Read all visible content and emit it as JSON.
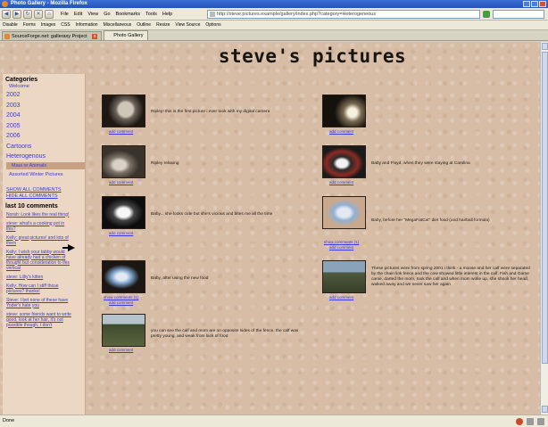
{
  "browser": {
    "title": "Photo Gallery - Mozilla Firefox",
    "menu": [
      "File",
      "Edit",
      "View",
      "Go",
      "Bookmarks",
      "Tools",
      "Help"
    ],
    "address": "http://steve.pictures.example/gallery/index.php?category=Heterogeneous",
    "bookmarks": [
      "Disable",
      "Forms",
      "Images",
      "CSS",
      "Information",
      "Miscellaneous",
      "Outline",
      "Resize",
      "View Source",
      "Options"
    ],
    "tabs": [
      {
        "label": "SourceForge.net: galleraxy Project"
      },
      {
        "label": "Photo Gallery"
      }
    ],
    "status": "Done"
  },
  "site": {
    "title": "steve's pictures"
  },
  "sidebar": {
    "categories_heading": "Categories",
    "welcome": "Welcome",
    "years": [
      "2002",
      "2003",
      "2004",
      "2005",
      "2006"
    ],
    "cartoons": "Cartoons",
    "heterogenous": "Heterogenous",
    "sub_active": "Maui or Animals",
    "sub_other": "Assorted Winter Pictures",
    "show_all": "SHOW ALL COMMENTS",
    "hide_all": "HIDE ALL COMMENTS",
    "comments_heading": "last 10 comments",
    "comments": [
      "Norah: Look likes the real thing!",
      "steve: what's a cooking pot in this?",
      "Kelly: great pictures! and lots of them",
      "Kelly: I wish your tabby would have already had a chicken of thought but consideration to this vertical",
      "steve: Lilliy's kitten",
      "Kelly: How can I stiff those pictures? thanks!",
      "Steve: I bet none of these have Yoder's hate you",
      "steve: some friends want to write good, look at her hair, it's not possible though, I don't"
    ]
  },
  "gallery": [
    {
      "caption": "Ripley! this is the first picture i ever took with my digital camera",
      "link": "add comment"
    },
    {
      "caption": "",
      "link": "add comment"
    },
    {
      "caption": "Ripley relaxing",
      "link": "add comment"
    },
    {
      "caption": "Baby and Floyd, when they were staying at Carolina",
      "link": "add comment"
    },
    {
      "caption": "Baby... she looks cute but she's vicious and bites me all the time",
      "link": "add comment"
    },
    {
      "caption": "Baby, before her \"MegaFatCat\" diet food (and hairball formula)",
      "link": "show comments (1)",
      "link2": "add comment"
    },
    {
      "caption": "Baby, after using the new food",
      "link": "show comments (1)",
      "link2": "add comment"
    },
    {
      "caption": "These pictures were from spring 2001 i think - a moose and her calf were separated by the chain link fence and the cow showed little interest in the calf. Fish and Game came, darted the mom, took the calf and when mom woke up, she shook her head, walked away and we never saw her again",
      "link": "add comment"
    },
    {
      "caption": "you can see the calf and mom are on opposite sides of the fence. the calf was pretty young, and weak from lack of food",
      "link": "add comment"
    }
  ]
}
